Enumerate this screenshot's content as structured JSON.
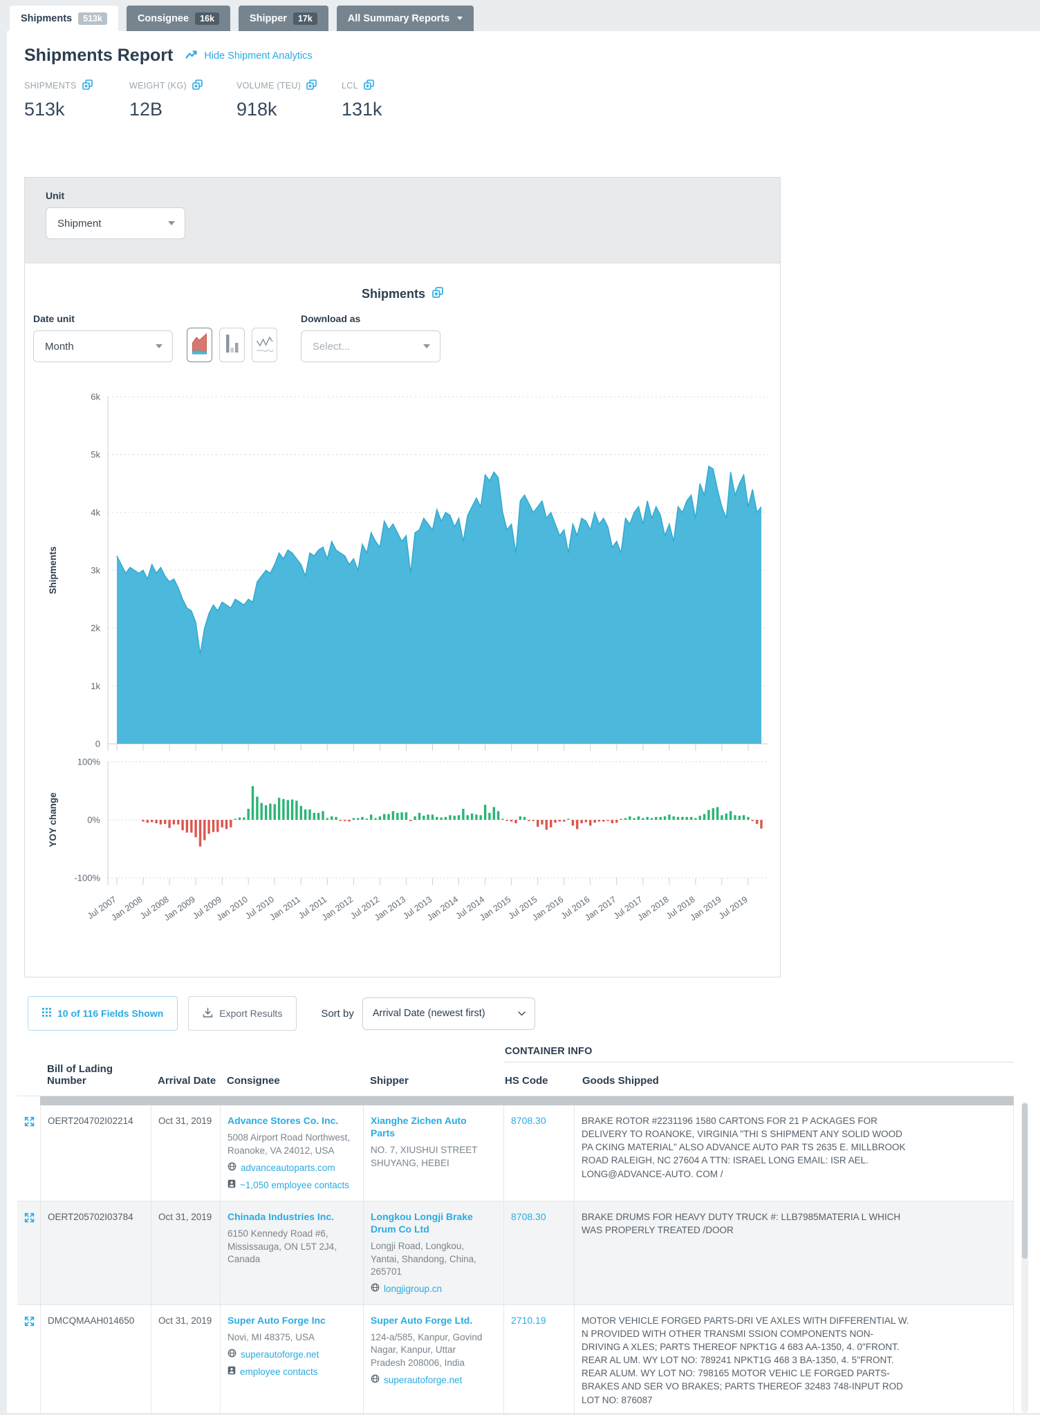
{
  "tabs": {
    "shipments": {
      "label": "Shipments",
      "badge": "513k"
    },
    "consignee": {
      "label": "Consignee",
      "badge": "16k"
    },
    "shipper": {
      "label": "Shipper",
      "badge": "17k"
    },
    "summary": {
      "label": "All Summary Reports"
    }
  },
  "header": {
    "title": "Shipments Report",
    "analytics_link": "Hide Shipment Analytics"
  },
  "stats": {
    "shipments": {
      "label": "SHIPMENTS",
      "value": "513k"
    },
    "weight": {
      "label": "WEIGHT (KG)",
      "value": "12B"
    },
    "volume": {
      "label": "VOLUME (TEU)",
      "value": "918k"
    },
    "lcl": {
      "label": "LCL",
      "value": "131k"
    }
  },
  "filters": {
    "unit_label": "Unit",
    "unit_value": "Shipment",
    "date_unit_label": "Date unit",
    "date_unit_value": "Month",
    "download_label": "Download as",
    "download_placeholder": "Select..."
  },
  "chart_data": {
    "type": "area+bar",
    "title": "Shipments",
    "x_start": "Jul 2007",
    "x_end": "Oct 2019",
    "x_unit": "month",
    "x_tick_labels": [
      "Jul 2007",
      "Jan 2008",
      "Jul 2008",
      "Jan 2009",
      "Jul 2009",
      "Jan 2010",
      "Jul 2010",
      "Jan 2011",
      "Jul 2011",
      "Jan 2012",
      "Jul 2012",
      "Jan 2013",
      "Jul 2013",
      "Jan 2014",
      "Jul 2014",
      "Jan 2015",
      "Jul 2015",
      "Jan 2016",
      "Jul 2016",
      "Jan 2017",
      "Jul 2017",
      "Jan 2018",
      "Jul 2018",
      "Jan 2019",
      "Jul 2019"
    ],
    "series": [
      {
        "name": "Shipments",
        "type": "area",
        "values": [
          3250,
          3100,
          2950,
          3050,
          3000,
          2950,
          3000,
          2850,
          3100,
          2950,
          3050,
          2900,
          2800,
          2850,
          2700,
          2500,
          2350,
          2300,
          2100,
          1550,
          2000,
          2250,
          2400,
          2300,
          2450,
          2400,
          2350,
          2500,
          2450,
          2400,
          2500,
          2450,
          2800,
          2900,
          3000,
          2950,
          3100,
          3300,
          3200,
          3350,
          3300,
          3200,
          3100,
          2900,
          3300,
          3250,
          3350,
          3400,
          3200,
          3500,
          3350,
          3300,
          3250,
          3100,
          3200,
          3000,
          3450,
          3300,
          3650,
          3500,
          3400,
          3850,
          3700,
          3800,
          3650,
          3500,
          3600,
          2950,
          3650,
          3700,
          3900,
          3800,
          3700,
          4050,
          3850,
          4000,
          3950,
          3750,
          3900,
          3500,
          3950,
          4100,
          4250,
          4100,
          4650,
          4550,
          4700,
          4600,
          4000,
          3700,
          3800,
          3300,
          4200,
          4300,
          4150,
          4000,
          4100,
          4200,
          3900,
          4000,
          3800,
          3600,
          3700,
          3300,
          3800,
          3600,
          3900,
          3850,
          3700,
          4000,
          3800,
          3900,
          3750,
          3400,
          3500,
          3300,
          3900,
          3800,
          4000,
          4100,
          3800,
          4200,
          3900,
          4100,
          3950,
          3600,
          3800,
          3500,
          4100,
          4000,
          4200,
          4300,
          3900,
          4500,
          4300,
          4800,
          4750,
          4400,
          4100,
          3900,
          4700,
          4300,
          4500,
          4650,
          4100,
          4400,
          4000,
          4100
        ]
      },
      {
        "name": "YOY change",
        "type": "bar",
        "unit": "%",
        "values": [
          null,
          null,
          null,
          null,
          null,
          null,
          -3,
          -5,
          -4,
          -6,
          -8,
          -7,
          -14,
          -8,
          -8,
          -18,
          -22,
          -22,
          -30,
          -46,
          -35,
          -24,
          -21,
          -21,
          -13,
          -16,
          -13,
          0,
          4,
          4,
          19,
          58,
          40,
          29,
          25,
          28,
          27,
          38,
          36,
          34,
          35,
          33,
          24,
          18,
          18,
          12,
          12,
          15,
          3,
          6,
          5,
          -1,
          -2,
          -3,
          3,
          3,
          5,
          2,
          9,
          3,
          6,
          10,
          10,
          15,
          12,
          13,
          13,
          -2,
          6,
          12,
          7,
          9,
          9,
          5,
          4,
          5,
          8,
          7,
          8,
          19,
          8,
          11,
          9,
          8,
          26,
          12,
          22,
          15,
          1,
          -1,
          -3,
          -6,
          6,
          5,
          -2,
          -2,
          -12,
          -8,
          -17,
          -13,
          -5,
          -3,
          -3,
          0,
          -10,
          -16,
          -6,
          -4,
          -10,
          -5,
          -3,
          -3,
          -1,
          -6,
          -5,
          0,
          3,
          6,
          3,
          6,
          3,
          5,
          3,
          5,
          5,
          6,
          9,
          6,
          5,
          5,
          5,
          5,
          3,
          7,
          10,
          17,
          20,
          22,
          8,
          11,
          15,
          8,
          7,
          8,
          5,
          -2,
          -7,
          -15
        ]
      }
    ],
    "y_axis_main": {
      "label": "Shipments",
      "ticks": [
        "0",
        "1k",
        "2k",
        "3k",
        "4k",
        "5k",
        "6k"
      ],
      "max": 6000,
      "grid": "dotted"
    },
    "y_axis_yoy": {
      "label": "YOY change",
      "ticks": [
        "-100%",
        "0%",
        "100%"
      ],
      "range": [
        -100,
        100
      ],
      "grid": "dotted"
    },
    "colors": {
      "area": "#4bb8dc",
      "area_stroke": "#31a8cf",
      "positive": "#2ab573",
      "negative": "#db574e"
    },
    "legend": "none"
  },
  "table_controls": {
    "fields_button": "10 of 116 Fields Shown",
    "export_button": "Export Results",
    "sort_label": "Sort by",
    "sort_value": "Arrival Date (newest first)"
  },
  "table": {
    "group_header": "CONTAINER INFO",
    "columns": [
      "Bill of Lading Number",
      "Arrival Date",
      "Consignee",
      "Shipper",
      "HS Code",
      "Goods Shipped"
    ],
    "rows": [
      {
        "bol": "OERT204702I02214",
        "arrival": "Oct 31, 2019",
        "consignee": {
          "name": "Advance Stores Co. Inc.",
          "address": "5008 Airport Road Northwest, Roanoke, VA 24012, USA",
          "website": "advanceautoparts.com",
          "contacts": "~1,050 employee contacts"
        },
        "shipper": {
          "name": "Xianghe Zichen Auto Parts",
          "address": "NO. 7, XIUSHUI STREET SHUYANG, HEBEI"
        },
        "hs_code": "8708.30",
        "goods": "BRAKE ROTOR #2231196 1580 CARTONS FOR 21 P ACKAGES FOR DELIVERY TO ROANOKE, VIRGINIA \"THI S SHIPMENT ANY SOLID WOOD PA CKING MATERIAL\" ALSO ADVANCE AUTO PAR TS 2635 E. MILLBROOK ROAD RALEIGH, NC 27604 A TTN: ISRAEL LONG EMAIL: ISR AEL. LONG@ADVANCE-AUTO. COM /"
      },
      {
        "bol": "OERT205702I03784",
        "arrival": "Oct 31, 2019",
        "consignee": {
          "name": "Chinada Industries Inc.",
          "address": "6150 Kennedy Road #6, Mississauga, ON L5T 2J4, Canada"
        },
        "shipper": {
          "name": "Longkou Longji Brake Drum Co Ltd",
          "address": "Longji Road, Longkou, Yantai, Shandong, China, 265701",
          "website": "longjigroup.cn"
        },
        "hs_code": "8708.30",
        "goods": "BRAKE DRUMS FOR HEAVY DUTY TRUCK #: LLB7985MATERIA L WHICH WAS PROPERLY TREATED /DOOR"
      },
      {
        "bol": "DMCQMAAH014650",
        "arrival": "Oct 31, 2019",
        "consignee": {
          "name": "Super Auto Forge Inc",
          "address": "Novi, MI 48375, USA",
          "website": "superautoforge.net",
          "contacts": "employee contacts"
        },
        "shipper": {
          "name": "Super Auto Forge Ltd.",
          "address": "124-a/585, Kanpur, Govind Nagar, Kanpur, Uttar Pradesh 208006, India",
          "website": "superautoforge.net"
        },
        "hs_code": "2710.19",
        "goods": "MOTOR VEHICLE FORGED PARTS-DRI VE AXLES WITH DIFFERENTIAL W. N PROVIDED WITH OTHER TRANSMI SSION COMPONENTS NON-DRIVING A XLES; PARTS THEREOF NPKT1G 4 683 AA-1350, 4. 0\"FRONT. REAR AL UM. WY LOT NO: 789241 NPKT1G 468 3 BA-1350, 4. 5\"FRONT. REAR ALUM. WY LOT NO: 798165 MOTOR VEHIC LE FORGED PARTS-BRAKES AND SER VO BRAKES; PARTS THEREOF 32483 748-INPUT ROD LOT NO: 876087"
      }
    ]
  }
}
